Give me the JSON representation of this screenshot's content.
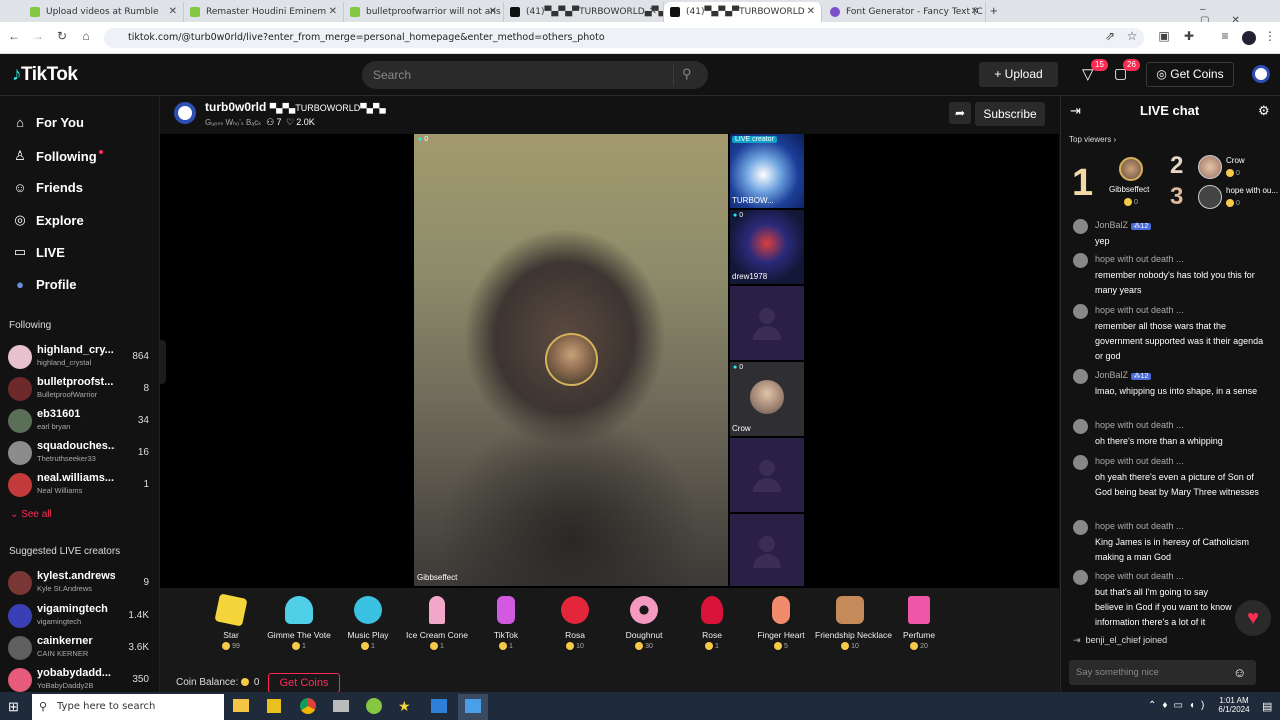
{
  "browser": {
    "tabs": [
      {
        "title": "Upload videos at Rumble",
        "color": "#85c742"
      },
      {
        "title": "Remaster Houdini Eminem",
        "color": "#85c742"
      },
      {
        "title": "bulletproofwarrior will not ans",
        "color": "#85c742"
      },
      {
        "title": "(41)▀▄▀▄▀TURBOWORLD▄▀▄",
        "color": "#111111"
      },
      {
        "title": "(41)▀▄▀▄▀TURBOWORLD",
        "color": "#111111"
      },
      {
        "title": "Font Generator - Fancy Text (C",
        "color": "#7b4fc9"
      }
    ],
    "url": "tiktok.com/@turb0w0rld/live?enter_from_merge=personal_homepage&enter_method=others_photo"
  },
  "header": {
    "logo": "TikTok",
    "search_placeholder": "Search",
    "upload_label": "Upload",
    "inbox_badge": "15",
    "messages_badge": "26",
    "get_coins_label": "Get Coins"
  },
  "sidebar": {
    "nav": [
      {
        "label": "For You",
        "icon": "⌂"
      },
      {
        "label": "Following",
        "icon": "♙"
      },
      {
        "label": "Friends",
        "icon": "☺"
      },
      {
        "label": "Explore",
        "icon": "◎"
      },
      {
        "label": "LIVE",
        "icon": "▭"
      },
      {
        "label": "Profile",
        "icon": "●"
      }
    ],
    "following_title": "Following",
    "following": [
      {
        "name": "highland_cry...",
        "sub": "highland_crystal",
        "count": "864",
        "color": "#e8c1cf"
      },
      {
        "name": "bulletproofst...",
        "sub": "BulletproofWarrior",
        "count": "8",
        "color": "#6e2a2a"
      },
      {
        "name": "eb31601",
        "sub": "earl bryan",
        "count": "34",
        "color": "#5a6e58"
      },
      {
        "name": "squadouches...",
        "sub": "Thetruthseeker33",
        "count": "16",
        "color": "#8c8c8c"
      },
      {
        "name": "neal.williams...",
        "sub": "Neal Williams",
        "count": "1",
        "color": "#c43a3a"
      }
    ],
    "see_all": "See all",
    "suggested_title": "Suggested LIVE creators",
    "suggested": [
      {
        "name": "kylest.andrews",
        "sub": "Kyle St.Andrews",
        "count": "9",
        "color": "#7a3535"
      },
      {
        "name": "vigamingtech",
        "sub": "vigamingtech",
        "count": "1.4K",
        "color": "#3b3fb5"
      },
      {
        "name": "cainkerner",
        "sub": "CAIN KERNER",
        "count": "3.6K",
        "color": "#5f5f5f"
      },
      {
        "name": "yobabydadd...",
        "sub": "YoBabyDaddy2B",
        "count": "350",
        "color": "#e65a7a"
      }
    ]
  },
  "stream": {
    "host_name": "turb0w0rld",
    "host_display": "▀▄▀▄TURBOWORLD▀▄▀▄",
    "host_tagline": "Gᵤₑₛₛ Wₕₒ'ₛ Bₐcₖ",
    "viewers": "7",
    "likes": "2.0K",
    "subscribe_label": "Subscribe",
    "main_count": "0",
    "main_label": "Gibbseffect",
    "tiles": [
      {
        "label": "TURBOW...",
        "count": "",
        "badge": "LIVE creator"
      },
      {
        "label": "drew1978",
        "count": "0"
      },
      {
        "label": "",
        "count": ""
      },
      {
        "label": "Crow",
        "count": "0"
      },
      {
        "label": "",
        "count": ""
      },
      {
        "label": "",
        "count": ""
      }
    ]
  },
  "gifts": [
    {
      "name": "Star",
      "price": "99",
      "color": "#f4d53b"
    },
    {
      "name": "Gimme The Vote",
      "price": "1",
      "color": "#4fd0e8"
    },
    {
      "name": "Music Play",
      "price": "1",
      "color": "#3ac0e0"
    },
    {
      "name": "Ice Cream Cone",
      "price": "1",
      "color": "#f2a6c9"
    },
    {
      "name": "TikTok",
      "price": "1",
      "color": "#d25ae0"
    },
    {
      "name": "Rosa",
      "price": "10",
      "color": "#e3263a"
    },
    {
      "name": "Doughnut",
      "price": "30",
      "color": "#f49ac0"
    },
    {
      "name": "Rose",
      "price": "1",
      "color": "#d9123a"
    },
    {
      "name": "Finger Heart",
      "price": "5",
      "color": "#f28b6b"
    },
    {
      "name": "Friendship Necklace",
      "price": "10",
      "color": "#c58a5a"
    },
    {
      "name": "Perfume",
      "price": "20",
      "color": "#f056a8"
    }
  ],
  "coin_balance_label": "Coin Balance:",
  "coin_balance_value": "0",
  "get_coins_bottom": "Get Coins",
  "chat": {
    "title": "LIVE chat",
    "top_viewers": "Top viewers",
    "top": [
      {
        "rank": "1",
        "name": "Gibbseffect",
        "value": "0"
      },
      {
        "rank": "2",
        "name": "Crow",
        "value": "0"
      },
      {
        "rank": "3",
        "name": "hope with ou...",
        "value": "0"
      }
    ],
    "messages": [
      {
        "user": "JonBalZ",
        "text": "yep",
        "level": "12"
      },
      {
        "user": "hope with out death ...",
        "text": "remember nobody's has told you this for many years"
      },
      {
        "user": "hope with out death ...",
        "text": "remember all those wars that the government supported was it their agenda or god"
      },
      {
        "user": "JonBalZ",
        "text": "lmao, whipping us into shape, in a sense",
        "level": "12"
      },
      {
        "user": "hope with out death ...",
        "text": "oh there's more than a whipping"
      },
      {
        "user": "hope with out death ...",
        "text": "oh yeah there's even a picture of Son of God being beat by Mary Three witnesses"
      },
      {
        "user": "hope with out death ...",
        "text": "King James is in heresy of Catholicism making a man God"
      },
      {
        "user": "hope with out death ...",
        "text": "but that's all I'm going to say believe in God if you want to know information there's a lot of it"
      }
    ],
    "join_notice": "benji_el_chief joined",
    "input_placeholder": "Say something nice"
  },
  "taskbar": {
    "search_placeholder": "Type here to search",
    "time": "1:01 AM",
    "date": "6/1/2024"
  }
}
